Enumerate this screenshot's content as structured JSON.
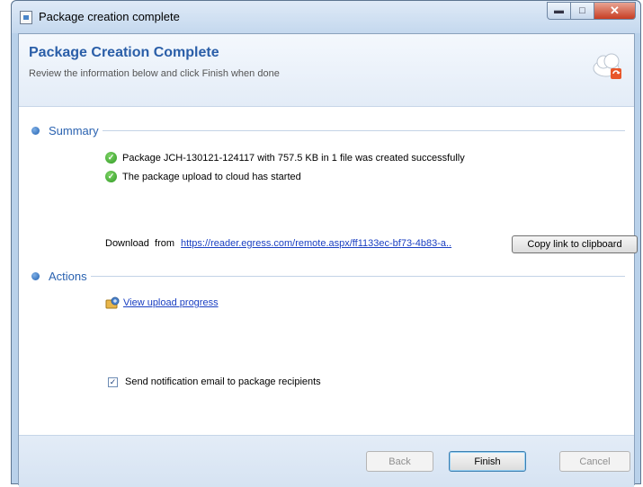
{
  "window": {
    "title": "Package creation complete"
  },
  "header": {
    "title": "Package Creation Complete",
    "subtitle": "Review the information below and click Finish when done"
  },
  "summary": {
    "label": "Summary",
    "status_lines": [
      "Package JCH-130121-124117 with 757.5 KB in 1 file was created successfully",
      "The package upload to cloud has started"
    ],
    "download_label": "Download  from",
    "download_link": "https://reader.egress.com/remote.aspx/ff1133ec-bf73-4b83-a..",
    "copy_button": "Copy link to clipboard"
  },
  "actions": {
    "label": "Actions",
    "view_progress_link": "View upload progress",
    "notify_checkbox": {
      "label": "Send notification email to package recipients",
      "checked": true
    }
  },
  "footer": {
    "back": "Back",
    "finish": "Finish",
    "cancel": "Cancel"
  },
  "colors": {
    "accent": "#2a5ea8",
    "link": "#1a3fc2",
    "success": "#2f9a24"
  }
}
